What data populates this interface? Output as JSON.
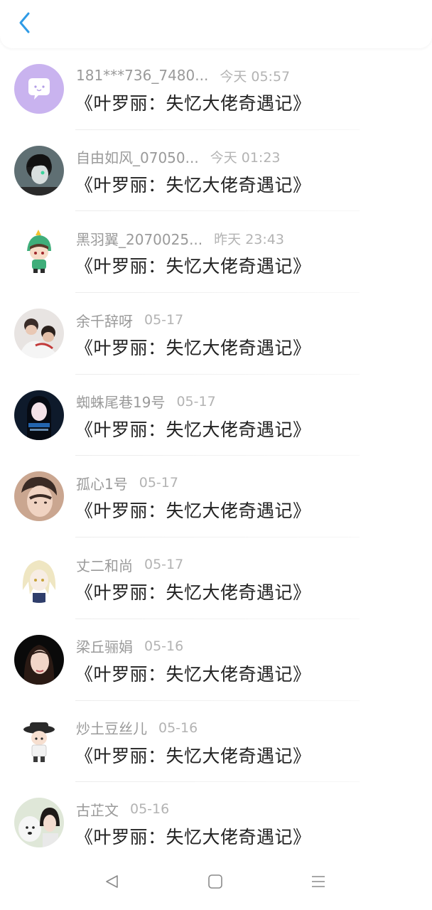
{
  "header": {
    "back_icon": "chevron-left-icon",
    "accent_color": "#2f9be6"
  },
  "messages": [
    {
      "name": "181***736_7480...",
      "time": "今天 05:57",
      "title": "《叶罗丽：失忆大佬奇遇记》",
      "avatar": "default-chat-bubble-avatar"
    },
    {
      "name": "自由如风_07050...",
      "time": "今天 01:23",
      "title": "《叶罗丽：失忆大佬奇遇记》",
      "avatar": "anime-boy-avatar"
    },
    {
      "name": "黑羽翼_2070025...",
      "time": "昨天 23:43",
      "title": "《叶罗丽：失忆大佬奇遇记》",
      "avatar": "dinosaur-hood-chibi-avatar"
    },
    {
      "name": "余千辞呀",
      "time": "05-17",
      "title": "《叶罗丽：失忆大佬奇遇记》",
      "avatar": "photo-two-people-avatar"
    },
    {
      "name": "蜘蛛尾巷19号",
      "time": "05-17",
      "title": "《叶罗丽：失忆大佬奇遇记》",
      "avatar": "anime-girl-dark-hair-avatar"
    },
    {
      "name": "孤心1号",
      "time": "05-17",
      "title": "《叶罗丽：失忆大佬奇遇记》",
      "avatar": "photo-boy-avatar"
    },
    {
      "name": "丈二和尚",
      "time": "05-17",
      "title": "《叶罗丽：失忆大佬奇遇记》",
      "avatar": "anime-blonde-boy-avatar"
    },
    {
      "name": "梁丘骊娟",
      "time": "05-16",
      "title": "《叶罗丽：失忆大佬奇遇记》",
      "avatar": "photo-woman-avatar"
    },
    {
      "name": "炒土豆丝儿",
      "time": "05-16",
      "title": "《叶罗丽：失忆大佬奇遇记》",
      "avatar": "chibi-hat-boy-avatar"
    },
    {
      "name": "古芷文",
      "time": "05-16",
      "title": "《叶罗丽：失忆大佬奇遇记》",
      "avatar": "photo-girl-with-dog-avatar"
    }
  ],
  "navbar": {
    "back": "triangle-back-icon",
    "home": "square-home-icon",
    "menu": "three-lines-menu-icon"
  }
}
